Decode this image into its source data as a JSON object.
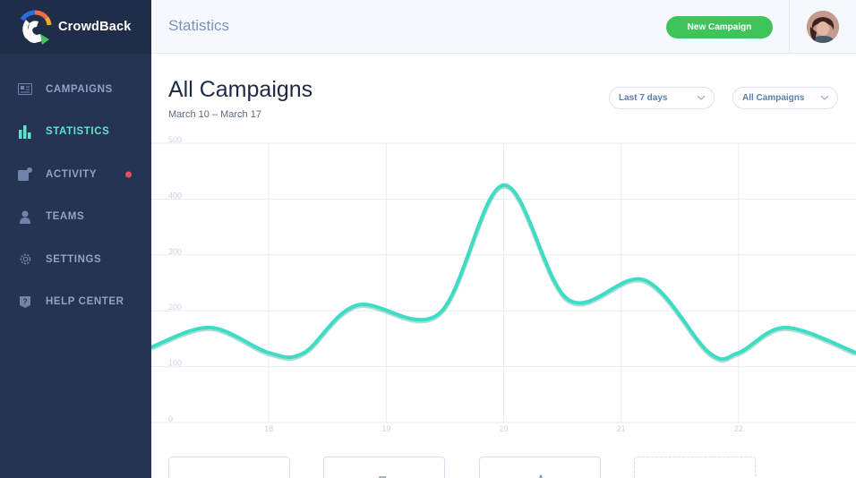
{
  "app": {
    "brand_name": "CrowdBack",
    "accent_color": "#3ddcc4",
    "sidebar_color": "#253452",
    "button_color": "#3fc45b"
  },
  "sidebar": {
    "items": [
      {
        "label": "CAMPAIGNS",
        "icon": "campaigns-icon",
        "active": false
      },
      {
        "label": "STATISTICS",
        "icon": "bar-chart-icon",
        "active": true
      },
      {
        "label": "ACTIVITY",
        "icon": "activity-icon",
        "active": false,
        "notification": true
      },
      {
        "label": "TEAMS",
        "icon": "teams-icon",
        "active": false
      },
      {
        "label": "SETTINGS",
        "icon": "gear-icon",
        "active": false
      },
      {
        "label": "HELP CENTER",
        "icon": "help-icon",
        "active": false
      }
    ]
  },
  "header": {
    "title": "Statistics",
    "new_campaign_label": "New Campaign"
  },
  "main": {
    "title": "All Campaigns",
    "date_range": "March 10 – March 17",
    "period_select": "Last 7 days",
    "campaign_select": "All Campaigns"
  },
  "chart_data": {
    "type": "line",
    "title": "",
    "xlabel": "",
    "ylabel": "",
    "ylim": [
      0,
      500
    ],
    "yticks": [
      "0",
      "100",
      "200",
      "300",
      "400",
      "500"
    ],
    "xticks": [
      "18",
      "19",
      "20",
      "21",
      "22"
    ],
    "grid": true,
    "series": [
      {
        "color": "#3ddcc4",
        "points": [
          [
            17.0,
            135
          ],
          [
            17.5,
            170
          ],
          [
            18.0,
            125
          ],
          [
            18.3,
            125
          ],
          [
            18.75,
            210
          ],
          [
            19.45,
            195
          ],
          [
            20.0,
            425
          ],
          [
            20.55,
            220
          ],
          [
            21.2,
            255
          ],
          [
            21.75,
            125
          ],
          [
            22.0,
            125
          ],
          [
            22.4,
            170
          ],
          [
            23.0,
            125
          ]
        ]
      }
    ]
  }
}
